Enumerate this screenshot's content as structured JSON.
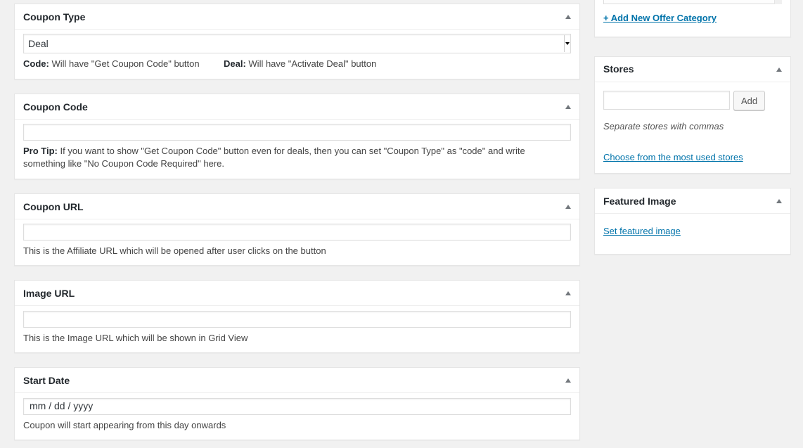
{
  "coupon_type": {
    "title": "Coupon Type",
    "selected": "Deal",
    "code_label": "Code:",
    "code_desc": " Will have \"Get Coupon Code\" button",
    "deal_label": "Deal:",
    "deal_desc": " Will have \"Activate Deal\" button"
  },
  "coupon_code": {
    "title": "Coupon Code",
    "value": "",
    "tip_label": "Pro Tip:",
    "tip_line1": " If you want to show \"Get Coupon Code\" button even for deals, then you can set \"Coupon Type\" as \"code\" and write",
    "tip_line2": "something like \"No Coupon Code Required\" here."
  },
  "coupon_url": {
    "title": "Coupon URL",
    "value": "",
    "desc": "This is the Affiliate URL which will be opened after user clicks on the button"
  },
  "image_url": {
    "title": "Image URL",
    "value": "",
    "desc": "This is the Image URL which will be shown in Grid View"
  },
  "start_date": {
    "title": "Start Date",
    "placeholder": "mm / dd / yyyy",
    "desc": "Coupon will start appearing from this day onwards"
  },
  "offer_category": {
    "add_link": "+ Add New Offer Category"
  },
  "stores": {
    "title": "Stores",
    "input_value": "",
    "add_button": "Add",
    "hint": "Separate stores with commas",
    "choose_link": "Choose from the most used stores"
  },
  "featured_image": {
    "title": "Featured Image",
    "set_link": "Set featured image"
  },
  "icons": {
    "toggle": "triangle-up-icon",
    "select": "chevron-down-icon"
  },
  "colors": {
    "link": "#0073aa",
    "background": "#f1f1f1",
    "panel": "#ffffff"
  }
}
